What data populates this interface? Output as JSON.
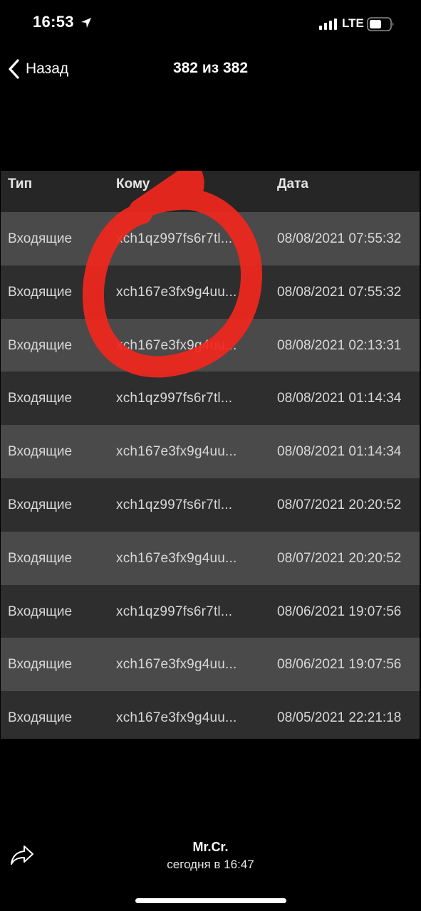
{
  "status_bar": {
    "time": "16:53",
    "network": "LTE",
    "icons": [
      "location-arrow-icon",
      "signal-icon",
      "battery-icon"
    ]
  },
  "nav": {
    "back_label": "Назад",
    "title": "382 из 382"
  },
  "table": {
    "headers": {
      "type": "Тип",
      "to": "Кому",
      "date": "Дата"
    },
    "rows": [
      {
        "type": "Входящие",
        "to": "xch1qz997fs6r7tl...",
        "date": "08/08/2021 07:55:32"
      },
      {
        "type": "Входящие",
        "to": "xch167e3fx9g4uu...",
        "date": "08/08/2021 07:55:32"
      },
      {
        "type": "Входящие",
        "to": "xch167e3fx9g4uu...",
        "date": "08/08/2021 02:13:31"
      },
      {
        "type": "Входящие",
        "to": "xch1qz997fs6r7tl...",
        "date": "08/08/2021 01:14:34"
      },
      {
        "type": "Входящие",
        "to": "xch167e3fx9g4uu...",
        "date": "08/08/2021 01:14:34"
      },
      {
        "type": "Входящие",
        "to": "xch1qz997fs6r7tl...",
        "date": "08/07/2021 20:20:52"
      },
      {
        "type": "Входящие",
        "to": "xch167e3fx9g4uu...",
        "date": "08/07/2021 20:20:52"
      },
      {
        "type": "Входящие",
        "to": "xch1qz997fs6r7tl...",
        "date": "08/06/2021 19:07:56"
      },
      {
        "type": "Входящие",
        "to": "xch167e3fx9g4uu...",
        "date": "08/06/2021 19:07:56"
      },
      {
        "type": "Входящие",
        "to": "xch167e3fx9g4uu...",
        "date": "08/05/2021 22:21:18"
      }
    ]
  },
  "annotation": {
    "shape": "hand-drawn circle",
    "color": "#f0271e"
  },
  "footer": {
    "sender": "Mr.Cr.",
    "timestamp": "сегодня в 16:47",
    "share_icon": "share-arrow-icon"
  },
  "colors": {
    "background": "#000000",
    "row_light": "#4a4a4a",
    "row_dark": "#2e2e2e",
    "header": "#262626"
  }
}
